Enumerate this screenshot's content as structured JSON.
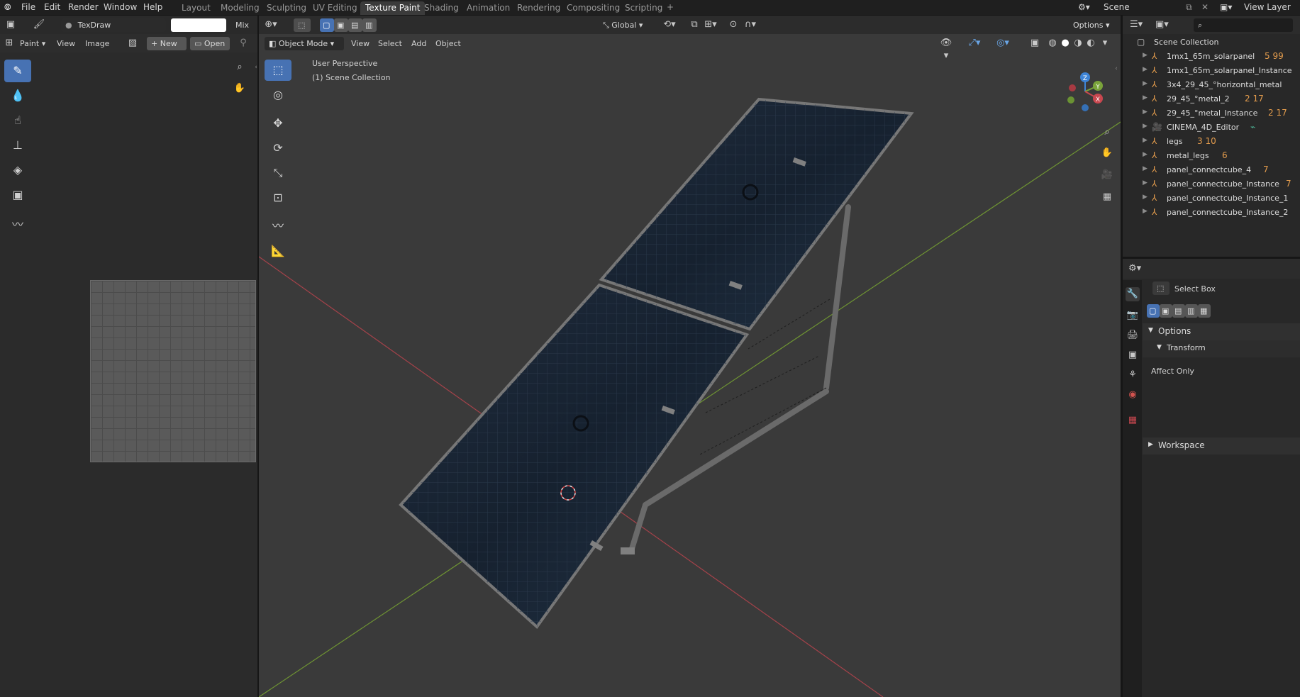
{
  "menu": {
    "file": "File",
    "edit": "Edit",
    "render": "Render",
    "window": "Window",
    "help": "Help"
  },
  "workspaces": [
    "Layout",
    "Modeling",
    "Sculpting",
    "UV Editing",
    "Texture Paint",
    "Shading",
    "Animation",
    "Rendering",
    "Compositing",
    "Scripting"
  ],
  "active_workspace": "Texture Paint",
  "scene": {
    "label": "Scene",
    "view_layer": "View Layer"
  },
  "image_editor": {
    "brush_name": "TexDraw",
    "blend_mode": "Mix",
    "mode": "Paint",
    "view": "View",
    "image": "Image",
    "new": "New",
    "open": "Open"
  },
  "viewport": {
    "mode": "Object Mode",
    "view": "View",
    "select": "Select",
    "add": "Add",
    "object": "Object",
    "orientation": "Global",
    "options": "Options",
    "perspective": "User Perspective",
    "collection": "(1) Scene Collection",
    "gizmo": {
      "z": "Z",
      "y": "Y",
      "x": "X"
    }
  },
  "outliner": {
    "root": "Scene Collection",
    "items": [
      {
        "name": "1mx1_65m_solarpanel",
        "tags": "5  99"
      },
      {
        "name": "1mx1_65m_solarpanel_Instance",
        "tags": ""
      },
      {
        "name": "3x4_29_45_°horizontal_metal",
        "tags": ""
      },
      {
        "name": "29_45_°metal_2",
        "tags": "2  17"
      },
      {
        "name": "29_45_°metal_Instance",
        "tags": "2  17"
      },
      {
        "name": "CINEMA_4D_Editor",
        "tags": ""
      },
      {
        "name": "legs",
        "tags": "3  10"
      },
      {
        "name": "metal_legs",
        "tags": "6"
      },
      {
        "name": "panel_connectcube_4",
        "tags": "7"
      },
      {
        "name": "panel_connectcube_Instance",
        "tags": "7"
      },
      {
        "name": "panel_connectcube_Instance_1",
        "tags": ""
      },
      {
        "name": "panel_connectcube_Instance_2",
        "tags": ""
      }
    ]
  },
  "properties": {
    "active_tool": "Select Box",
    "options": "Options",
    "transform": "Transform",
    "affect_only": "Affect Only",
    "workspace": "Workspace"
  },
  "colors": {
    "accent": "#4772b3",
    "axis_x": "#c9474f",
    "axis_y": "#7aa33a",
    "axis_z": "#3e84d6",
    "object_orange": "#e59d4d"
  },
  "icons": {
    "search": "search-icon",
    "hand": "hand-icon",
    "camera": "camera-icon",
    "grid": "grid-icon"
  }
}
